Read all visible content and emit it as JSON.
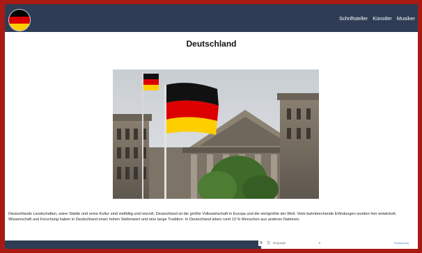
{
  "page": {
    "title": "Deutschland",
    "intro": "Deutschlands Landschaften, seine Städte und seine Kultur sind vielfältig und reizvoll. Deutschland ist die größte Volkswirtschaft in Europa und die viertgrößte der Welt. Viele bahnbrechende Erfindungen wurden hier entwickelt. Wissenschaft und Forschung haben in Deutschland einen hohen Stellenwert und eine lange Tradition. In Deutschland leben rund 13 % Menschen aus anderen Nationen."
  },
  "nav": {
    "links": [
      "Schriftsteller",
      "Künstler",
      "Musiker"
    ]
  },
  "hero": {
    "icon": "reichstag-photo"
  },
  "footer": {
    "close_label": "x",
    "language_select": "language",
    "powered_by": "Powered by"
  },
  "colors": {
    "navbar": "#2e3d55",
    "frame": "#a81a14",
    "flag_black": "#000000",
    "flag_red": "#dd0000",
    "flag_gold": "#ffce00"
  }
}
